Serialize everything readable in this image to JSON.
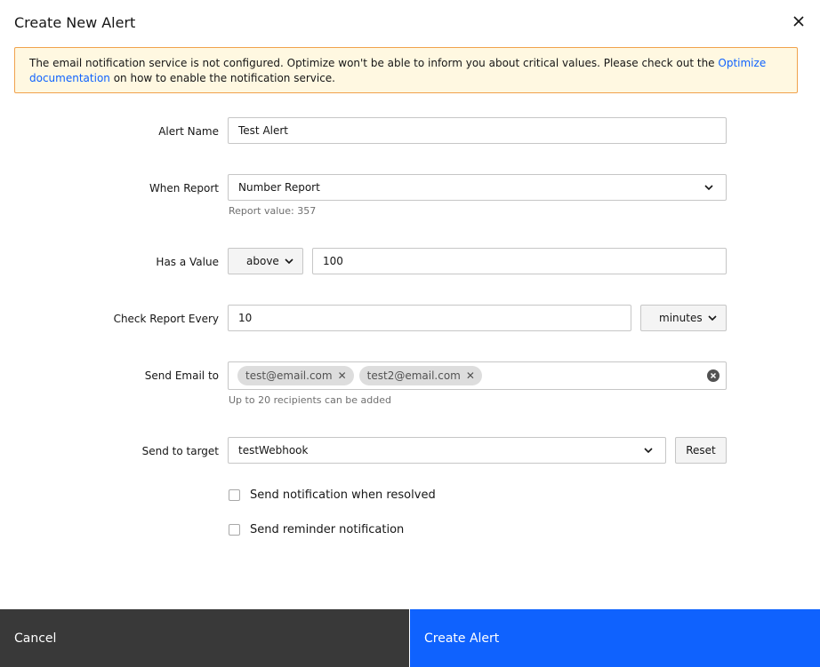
{
  "modal": {
    "title": "Create New Alert",
    "close_icon": "close-icon"
  },
  "warning": {
    "text_before": "The email notification service is not configured. Optimize won't be able to inform you about critical values. Please check out the ",
    "link_text": "Optimize documentation",
    "text_after": " on how to enable the notification service.",
    "border_color": "#f1a24c",
    "background_color": "#fff8e1"
  },
  "form": {
    "alert_name": {
      "label": "Alert Name",
      "value": "Test Alert"
    },
    "when_report": {
      "label": "When Report",
      "value": "Number Report",
      "helper": "Report value: 357"
    },
    "has_value": {
      "label": "Has a Value",
      "operator": "above",
      "threshold": "100"
    },
    "check_every": {
      "label": "Check Report Every",
      "value": "10",
      "unit": "minutes"
    },
    "send_email": {
      "label": "Send Email to",
      "recipients": [
        "test@email.com",
        "test2@email.com"
      ],
      "helper": "Up to 20 recipients can be added"
    },
    "send_target": {
      "label": "Send to target",
      "value": "testWebhook",
      "reset_label": "Reset"
    },
    "checkbox_resolved": {
      "label": "Send notification when resolved",
      "checked": false
    },
    "checkbox_reminder": {
      "label": "Send reminder notification",
      "checked": false
    }
  },
  "footer": {
    "cancel_label": "Cancel",
    "create_label": "Create Alert",
    "cancel_color": "#393939",
    "create_color": "#0f62fe"
  }
}
